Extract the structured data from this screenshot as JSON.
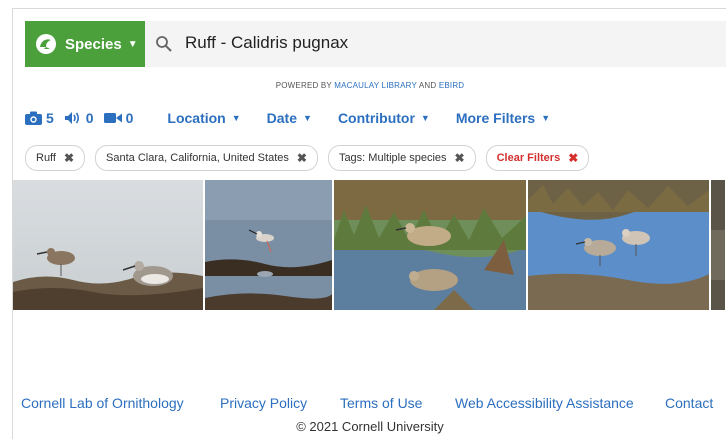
{
  "search": {
    "species_button_label": "Species",
    "query": "Ruff - Calidris pugnax"
  },
  "powered_by": {
    "prefix": "POWERED BY",
    "macaulay": "MACAULAY LIBRARY",
    "and": "AND",
    "ebird": "EBIRD"
  },
  "media_counts": {
    "photos": "5",
    "audio": "0",
    "video": "0"
  },
  "filters": {
    "location": "Location",
    "date": "Date",
    "contributor": "Contributor",
    "more": "More Filters"
  },
  "chips": [
    {
      "label": "Ruff"
    },
    {
      "label": "Santa Clara, California, United States"
    },
    {
      "label": "Tags: Multiple species"
    },
    {
      "label": "Clear Filters"
    }
  ],
  "footer": {
    "links": [
      "Cornell Lab of Ornithology",
      "Privacy Policy",
      "Terms of Use",
      "Web Accessibility Assistance",
      "Contact"
    ],
    "copyright": "© 2021 Cornell University"
  },
  "colors": {
    "brand_green": "#4ba03c",
    "link_blue": "#2c6fbf",
    "clear_red": "#d3302f"
  },
  "icons": {
    "logo": "ebird-logo-icon",
    "search": "search-icon",
    "camera": "camera-icon",
    "audio": "speaker-icon",
    "video": "video-icon",
    "close": "close-icon",
    "caret": "chevron-down-icon"
  }
}
